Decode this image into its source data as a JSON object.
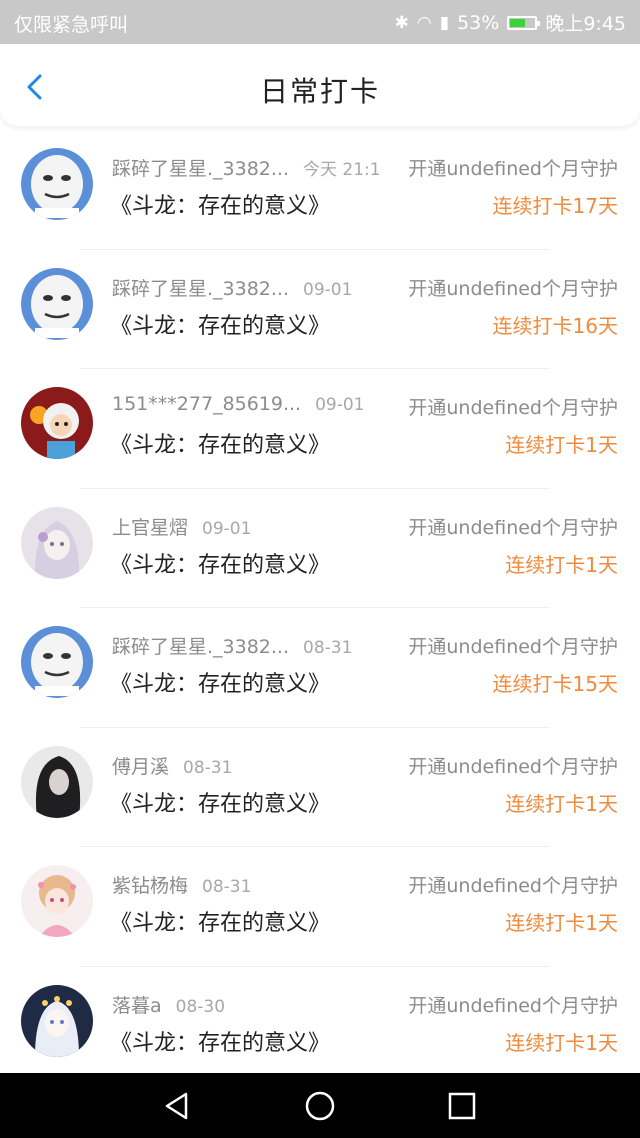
{
  "statusbar": {
    "left_text": "仅限紧急呼叫",
    "battery": "53%",
    "time": "晚上9:45",
    "icons": [
      "bluetooth-icon",
      "wifi-icon",
      "signal-icon",
      "battery-icon"
    ]
  },
  "header": {
    "title": "日常打卡",
    "back_icon": "chevron-left-icon"
  },
  "colors": {
    "accent": "#1e88e5",
    "streak": "#f08a3c",
    "muted": "#8c8c8c"
  },
  "items": [
    {
      "name": "踩碎了星星._3382...",
      "date": "今天 21:1",
      "guard": "开通undefined个月守护",
      "book": "《斗龙：存在的意义》",
      "streak": "连续打卡17天",
      "avatar": "meme-face"
    },
    {
      "name": "踩碎了星星._3382...",
      "date": "09-01",
      "guard": "开通undefined个月守护",
      "book": "《斗龙：存在的意义》",
      "streak": "连续打卡16天",
      "avatar": "meme-face"
    },
    {
      "name": "151***277_85619...",
      "date": "09-01",
      "guard": "开通undefined个月守护",
      "book": "《斗龙：存在的意义》",
      "streak": "连续打卡1天",
      "avatar": "sheep"
    },
    {
      "name": "上官星熠",
      "date": "09-01",
      "guard": "开通undefined个月守护",
      "book": "《斗龙：存在的意义》",
      "streak": "连续打卡1天",
      "avatar": "anime-white"
    },
    {
      "name": "踩碎了星星._3382...",
      "date": "08-31",
      "guard": "开通undefined个月守护",
      "book": "《斗龙：存在的意义》",
      "streak": "连续打卡15天",
      "avatar": "meme-face"
    },
    {
      "name": "傅月溪",
      "date": "08-31",
      "guard": "开通undefined个月守护",
      "book": "《斗龙：存在的意义》",
      "streak": "连续打卡1天",
      "avatar": "dark-hair"
    },
    {
      "name": "紫钻杨梅",
      "date": "08-31",
      "guard": "开通undefined个月守护",
      "book": "《斗龙：存在的意义》",
      "streak": "连续打卡1天",
      "avatar": "anime-pink"
    },
    {
      "name": "落暮a",
      "date": "08-30",
      "guard": "开通undefined个月守护",
      "book": "《斗龙：存在的意义》",
      "streak": "连续打卡1天",
      "avatar": "anime-blue"
    }
  ],
  "navbar": {
    "buttons": [
      "back-triangle-icon",
      "home-circle-icon",
      "recents-square-icon"
    ]
  }
}
